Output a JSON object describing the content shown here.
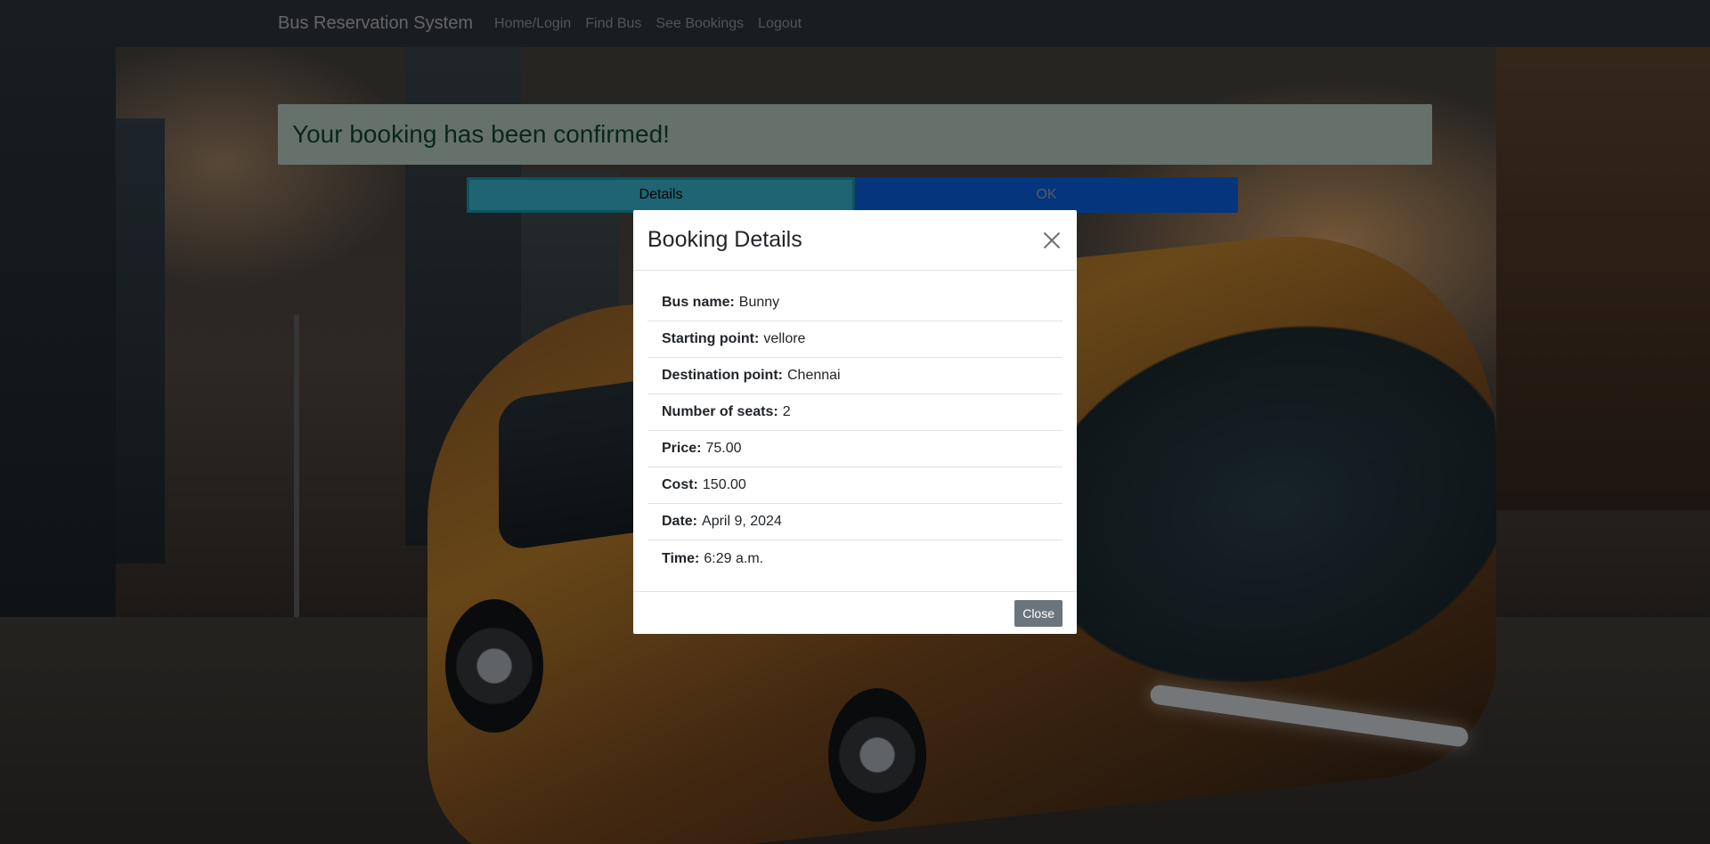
{
  "navbar": {
    "brand": "Bus Reservation System",
    "links": [
      "Home/Login",
      "Find Bus",
      "See Bookings",
      "Logout"
    ]
  },
  "alert": {
    "message": "Your booking has been confirmed!"
  },
  "buttons": {
    "details": "Details",
    "ok": "OK"
  },
  "modal": {
    "title": "Booking Details",
    "close_label": "Close",
    "items": [
      {
        "label": "Bus name:",
        "value": "Bunny"
      },
      {
        "label": "Starting point:",
        "value": "vellore"
      },
      {
        "label": "Destination point:",
        "value": "Chennai"
      },
      {
        "label": "Number of seats:",
        "value": "2"
      },
      {
        "label": "Price:",
        "value": "75.00"
      },
      {
        "label": "Cost:",
        "value": "150.00"
      },
      {
        "label": "Date:",
        "value": "April 9, 2024"
      },
      {
        "label": "Time:",
        "value": "6:29 a.m."
      }
    ]
  },
  "colors": {
    "navbar_bg": "#343a40",
    "alert_bg": "#cfe2d6",
    "alert_text": "#0f5132",
    "details_btn": "#3fc9e4",
    "ok_btn": "#0b6cfb",
    "close_btn": "#6c757d"
  }
}
